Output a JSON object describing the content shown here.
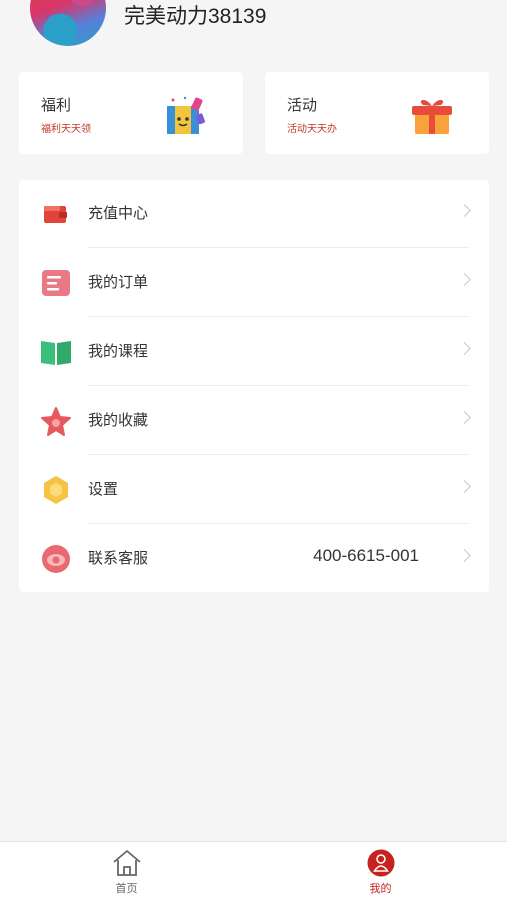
{
  "profile": {
    "username": "完美动力38139"
  },
  "cards": [
    {
      "title": "福利",
      "subtitle": "福利天天领",
      "icon": "gift-box-character-icon"
    },
    {
      "title": "活动",
      "subtitle": "活动天天办",
      "icon": "gift-icon"
    }
  ],
  "menu": [
    {
      "label": "充值中心",
      "icon": "wallet-icon",
      "value": ""
    },
    {
      "label": "我的订单",
      "icon": "order-icon",
      "value": ""
    },
    {
      "label": "我的课程",
      "icon": "book-icon",
      "value": ""
    },
    {
      "label": "我的收藏",
      "icon": "star-icon",
      "value": ""
    },
    {
      "label": "设置",
      "icon": "settings-hexagon-icon",
      "value": ""
    },
    {
      "label": "联系客服",
      "icon": "customer-service-icon",
      "value": "400-6615-001"
    }
  ],
  "tabbar": {
    "items": [
      {
        "label": "首页",
        "icon": "home-icon",
        "active": false
      },
      {
        "label": "我的",
        "icon": "user-icon",
        "active": true
      }
    ]
  },
  "colors": {
    "accent": "#c7221f",
    "background": "#f5f5f5"
  }
}
